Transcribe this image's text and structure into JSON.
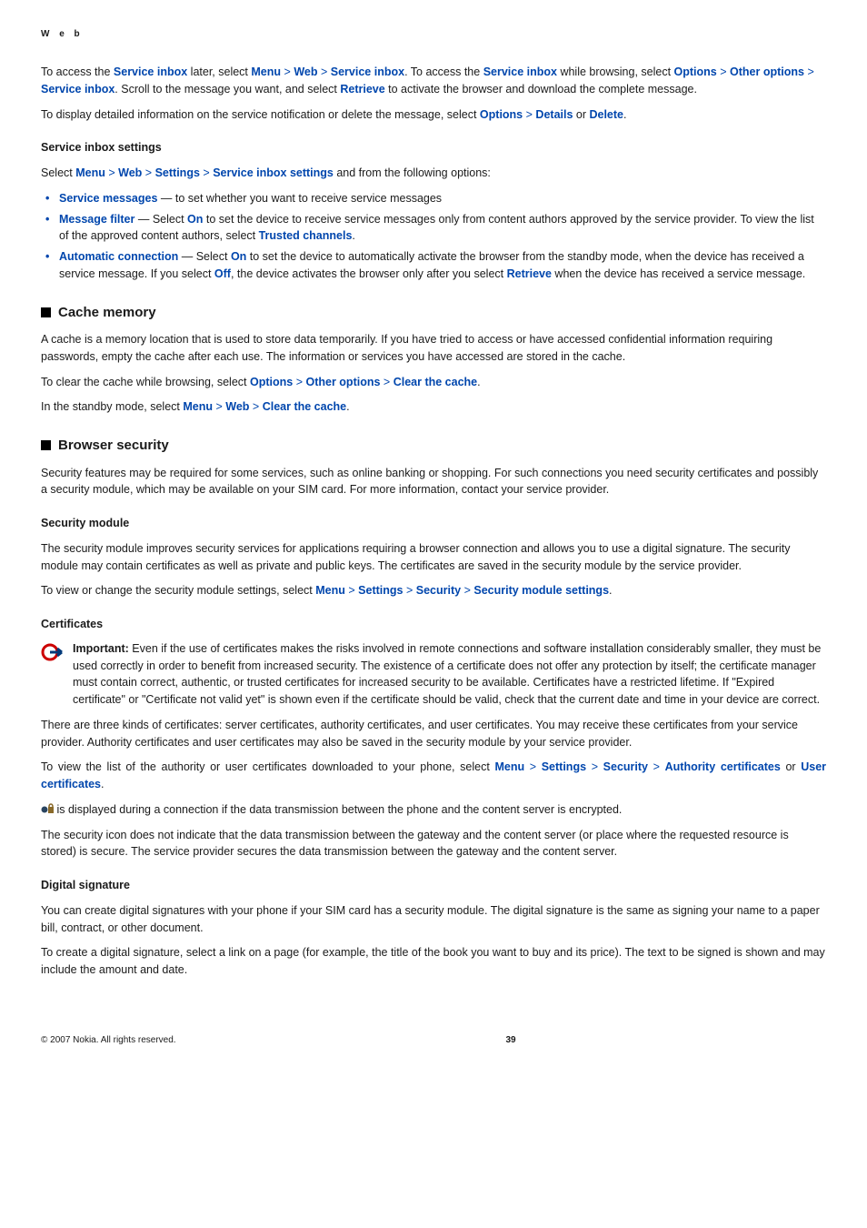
{
  "header": "W e b",
  "p1": {
    "t1": "To access the ",
    "l1": "Service inbox",
    "t2": " later, select ",
    "l2": "Menu",
    "l3": "Web",
    "l4": "Service inbox",
    "t3": ". To access the ",
    "l5": "Service inbox",
    "t4": " while browsing, select ",
    "l6": "Options",
    "l7": "Other options",
    "l8": "Service inbox",
    "t5": ". Scroll to the message you want, and select ",
    "l9": "Retrieve",
    "t6": " to activate the browser and download the complete message."
  },
  "p2": {
    "t1": "To display detailed information on the service notification or delete the message, select ",
    "l1": "Options",
    "l2": "Details",
    "t2": " or ",
    "l3": "Delete",
    "t3": "."
  },
  "h_sis": "Service inbox settings",
  "p3": {
    "t1": "Select ",
    "l1": "Menu",
    "l2": "Web",
    "l3": "Settings",
    "l4": "Service inbox settings",
    "t2": " and from the following options:"
  },
  "bul1": {
    "l1": "Service messages",
    "t1": " — to set whether you want to receive service messages"
  },
  "bul2": {
    "l1": "Message filter",
    "t1": " — Select ",
    "l2": "On",
    "t2": " to set the device to receive service messages only from content authors approved by the service provider. To view the list of the approved content authors, select ",
    "l3": "Trusted channels",
    "t3": "."
  },
  "bul3": {
    "l1": "Automatic connection",
    "t1": " — Select ",
    "l2": "On",
    "t2": " to set the device to automatically activate the browser from the standby mode, when the device has received a service message. If you select ",
    "l3": "Off",
    "t3": ", the device activates the browser only after you select ",
    "l4": "Retrieve",
    "t4": " when the device has received a service message."
  },
  "h_cache": "Cache memory",
  "p_cache1": "A cache is a memory location that is used to store data temporarily. If you have tried to access or have accessed confidential information requiring passwords, empty the cache after each use. The information or services you have accessed are stored in the cache.",
  "p_cache2": {
    "t1": "To clear the cache while browsing, select ",
    "l1": "Options",
    "l2": "Other options",
    "l3": "Clear the cache",
    "t2": "."
  },
  "p_cache3": {
    "t1": "In the standby mode, select ",
    "l1": "Menu",
    "l2": "Web",
    "l3": "Clear the cache",
    "t2": "."
  },
  "h_bsec": "Browser security",
  "p_bsec": "Security features may be required for some services, such as online banking or shopping. For such connections you need security certificates and possibly a security module, which may be available on your SIM card. For more information, contact your service provider.",
  "h_secmod": "Security module",
  "p_secmod1": "The security module improves security services for applications requiring a browser connection and allows you to use a digital signature. The security module may contain certificates as well as private and public keys. The certificates are saved in the security module by the service provider.",
  "p_secmod2": {
    "t1": "To view or change the security module settings, select ",
    "l1": "Menu",
    "l2": "Settings",
    "l3": "Security",
    "l4": "Security module settings",
    "t2": "."
  },
  "h_cert": "Certificates",
  "p_imp": {
    "label": "Important:  ",
    "text": "Even if the use of certificates makes the risks involved in remote connections and software installation considerably smaller, they must be used correctly in order to benefit from increased security. The existence of a certificate does not offer any protection by itself; the certificate manager must contain correct, authentic, or trusted certificates for increased security to be available. Certificates have a restricted lifetime. If \"Expired certificate\" or \"Certificate not valid yet\" is shown even if the certificate should be valid, check that the current date and time in your device are correct."
  },
  "p_cert2": "There are three kinds of certificates: server certificates, authority certificates, and user certificates. You may receive these certificates from your service provider. Authority certificates and user certificates may also be saved in the security module by your service provider.",
  "p_cert3": {
    "t1": "To view the list of the authority or user certificates downloaded to your phone, select ",
    "l1": "Menu",
    "l2": "Settings",
    "l3": "Security",
    "l4": "Authority certificates",
    "t2": " or ",
    "l5": "User certificates",
    "t3": "."
  },
  "p_cert4": " is displayed during a connection if the data transmission between the phone and the content server is encrypted.",
  "p_cert5": "The security icon does not indicate that the data transmission between the gateway and the content server (or place where the requested resource is stored) is secure. The service provider secures the data transmission between the gateway and the content server.",
  "h_dsig": "Digital signature",
  "p_dsig1": "You can create digital signatures with your phone if your SIM card has a security module. The digital signature is the same as signing your name to a paper bill, contract, or other document.",
  "p_dsig2": "To create a digital signature, select a link on a page (for example, the title of the book you want to buy and its price). The text to be signed is shown and may include the amount and date.",
  "footer": {
    "copy": "© 2007 Nokia. All rights reserved.",
    "page": "39"
  }
}
